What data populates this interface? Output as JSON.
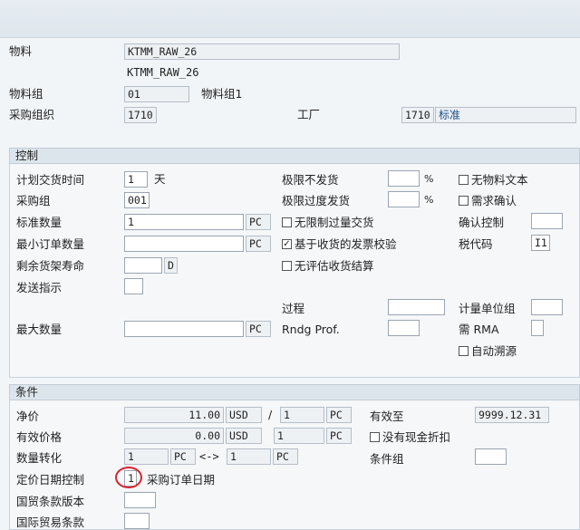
{
  "header": {
    "material_label": "物料",
    "material_value": "KTMM_RAW_26",
    "material_desc": "KTMM_RAW_26",
    "material_group_label": "物料组",
    "material_group_value": "01",
    "material_group_desc": "物料组1",
    "purch_org_label": "采购组织",
    "purch_org_value": "1710",
    "plant_label": "工厂",
    "plant_value": "1710",
    "plant_desc": "标准"
  },
  "control": {
    "title": "控制",
    "plan_delivery_time_label": "计划交货时间",
    "plan_delivery_time_value": "1",
    "plan_delivery_time_unit": "天",
    "purch_group_label": "采购组",
    "purch_group_value": "001",
    "std_qty_label": "标准数量",
    "std_qty_value": "1",
    "std_qty_unit": "PC",
    "min_order_qty_label": "最小订单数量",
    "min_order_qty_value": "",
    "min_order_qty_unit": "PC",
    "rem_shelf_life_label": "剩余货架寿命",
    "rem_shelf_life_value": "",
    "rem_shelf_life_unit": "D",
    "shipping_instr_label": "发送指示",
    "shipping_instr_value": "",
    "max_qty_label": "最大数量",
    "max_qty_value": "",
    "max_qty_unit": "PC",
    "underdel_tol_label": "极限不发货",
    "underdel_tol_value": "",
    "underdel_tol_unit": "%",
    "overdel_tol_label": "极限过度发货",
    "overdel_tol_value": "",
    "overdel_tol_unit": "%",
    "unlimited_label": "无限制过量交货",
    "unlimited_checked": false,
    "gr_based_iv_label": "基于收货的发票校验",
    "gr_based_iv_checked": true,
    "no_eval_gr_label": "无评估收货结算",
    "no_eval_gr_checked": false,
    "procedure_label": "过程",
    "procedure_value": "",
    "rndg_prof_label": "Rndg Prof.",
    "rndg_prof_value": "",
    "no_mat_text_label": "无物料文本",
    "no_mat_text_checked": false,
    "ack_reqd_label": "需求确认",
    "ack_reqd_checked": false,
    "conf_control_label": "确认控制",
    "conf_control_value": "",
    "tax_code_label": "税代码",
    "tax_code_value": "I1",
    "unit_measure_grp_label": "计量单位组",
    "unit_measure_grp_value": "",
    "rma_label": "需 RMA",
    "rma_value": "",
    "auto_source_label": "自动溯源",
    "auto_source_checked": false
  },
  "conditions": {
    "title": "条件",
    "net_price_label": "净价",
    "net_price_value": "11.00",
    "net_price_currency": "USD",
    "net_price_per": "1",
    "net_price_unit": "PC",
    "eff_price_label": "有效价格",
    "eff_price_value": "0.00",
    "eff_price_currency": "USD",
    "eff_price_per": "1",
    "eff_price_unit": "PC",
    "qty_conv_label": "数量转化",
    "qty_conv_left": "1",
    "qty_conv_left_unit": "PC",
    "qty_conv_arrow": "<->",
    "qty_conv_right": "1",
    "qty_conv_right_unit": "PC",
    "price_date_ctrl_label": "定价日期控制",
    "price_date_ctrl_value": "1",
    "price_date_ctrl_desc": "采购订单日期",
    "incoterms_version_label": "国贸条款版本",
    "incoterms_version_value": "",
    "incoterms_label": "国际贸易条款",
    "incoterms_value": "",
    "valid_to_label": "有效至",
    "valid_to_value": "9999.12.31",
    "no_cash_disc_label": "没有现金折扣",
    "no_cash_disc_checked": false,
    "cond_group_label": "条件组",
    "cond_group_value": "",
    "slash": "/"
  },
  "colors": {
    "highlight_circle": "#d9232e",
    "section_header": "#dde5ec",
    "background": "#f2f5f8"
  }
}
